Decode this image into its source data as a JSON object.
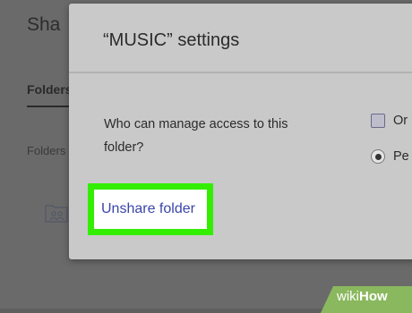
{
  "background": {
    "page_title_partial": "Sha",
    "tab_partial": "Folders",
    "folders_label_partial": "Folders",
    "folder_icon": "shared-folder-icon"
  },
  "modal": {
    "title": "“MUSIC” settings",
    "question": "Who can manage access to this folder?",
    "options": [
      {
        "label": "Or",
        "control": "checkbox",
        "checked": false
      },
      {
        "label": "Pe",
        "control": "radio",
        "selected": true
      }
    ],
    "unshare_label": "Unshare folder"
  },
  "highlight_color": "#33ee00",
  "link_color": "#3b45a8",
  "watermark": {
    "wiki": "wiki",
    "how": "How"
  }
}
